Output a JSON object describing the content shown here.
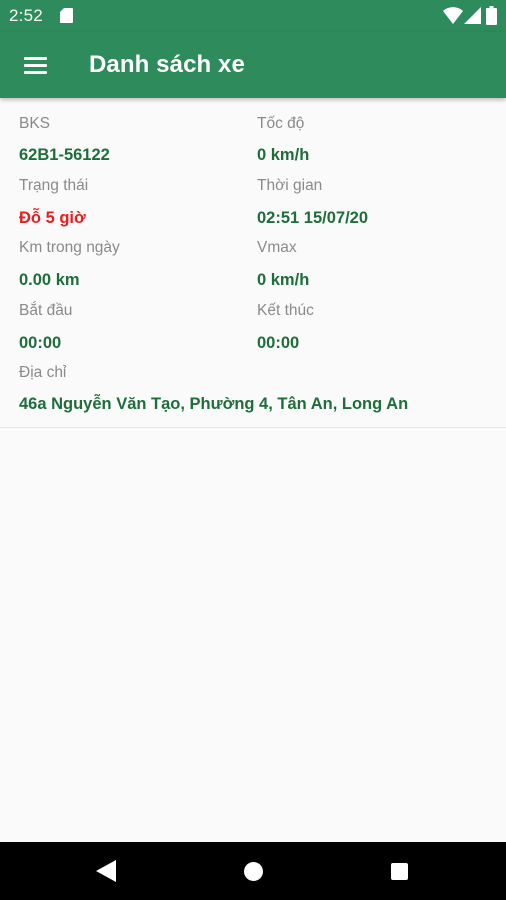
{
  "status_bar": {
    "time": "2:52"
  },
  "app_bar": {
    "title": "Danh sách xe"
  },
  "vehicle": {
    "plate_label": "BKS",
    "plate_value": "62B1-56122",
    "speed_label": "Tốc độ",
    "speed_value": "0 km/h",
    "status_label": "Trạng thái",
    "status_value": "Đỗ 5 giờ",
    "time_label": "Thời gian",
    "time_value": "02:51 15/07/20",
    "daily_km_label": "Km trong ngày",
    "daily_km_value": "0.00 km",
    "vmax_label": "Vmax",
    "vmax_value": "0 km/h",
    "start_label": "Bắt đầu",
    "start_value": "00:00",
    "end_label": "Kết thúc",
    "end_value": "00:00",
    "address_label": "Địa chỉ",
    "address_value": "46a Nguyễn Văn Tạo, Phường 4, Tân An, Long An"
  },
  "colors": {
    "primary": "#2e8b5b",
    "value_green": "#1d6e3a",
    "status_red": "#e81e1e",
    "label_gray": "#8a8a8a",
    "background": "#fafafa"
  },
  "icons": {
    "status_bar": [
      "sd-card-icon",
      "wifi-icon",
      "signal-icon",
      "battery-icon"
    ],
    "app_bar": [
      "menu-icon"
    ],
    "nav_bar": [
      "back-icon",
      "home-icon",
      "recents-icon"
    ]
  }
}
